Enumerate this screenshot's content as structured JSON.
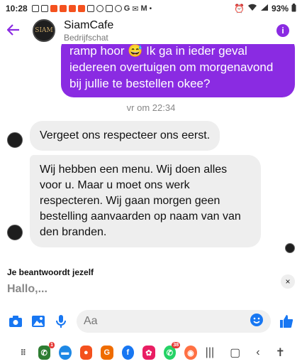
{
  "status_bar": {
    "time": "10:28",
    "battery": "93%"
  },
  "header": {
    "title": "SiamCafe",
    "subtitle": "Bedrijfschat",
    "avatar_text": "SIAM",
    "info_label": "i"
  },
  "messages": {
    "outgoing_text": "ramp hoor 😅 Ik ga in ieder geval iedereen overtuigen om morgenavond bij jullie te bestellen okee?",
    "timestamp": "vr om 22:34",
    "incoming": [
      {
        "text": "Vergeet ons  respecteer ons eerst."
      },
      {
        "text": "Wij hebben een menu. Wij doen alles voor u. Maar u moet ons werk respecteren. Wij  gaan  morgen  geen bestelling aanvaarden op naam  van van den branden."
      }
    ]
  },
  "reply_panel": {
    "label": "Je beantwoordt jezelf",
    "preview": "Hallo,...",
    "close": "×"
  },
  "composer": {
    "placeholder": "Aa"
  },
  "nav_apps": [
    {
      "name": "apps-grid",
      "color": "#555555",
      "badge": ""
    },
    {
      "name": "phone",
      "color": "#2e7d32",
      "badge": "1"
    },
    {
      "name": "messages",
      "color": "#1e88e5",
      "badge": ""
    },
    {
      "name": "contacts",
      "color": "#f4511e",
      "badge": ""
    },
    {
      "name": "gmail-app",
      "color": "#ef6c00",
      "badge": ""
    },
    {
      "name": "facebook",
      "color": "#1877f2",
      "badge": ""
    },
    {
      "name": "flower-app",
      "color": "#e91e63",
      "badge": ""
    },
    {
      "name": "whatsapp",
      "color": "#25d366",
      "badge": "38"
    },
    {
      "name": "brand-app",
      "color": "#ff7043",
      "badge": ""
    }
  ],
  "colors": {
    "accent": "#8a2be2",
    "incoming_bg": "#eeeeee",
    "composer_blue": "#1877f2"
  }
}
